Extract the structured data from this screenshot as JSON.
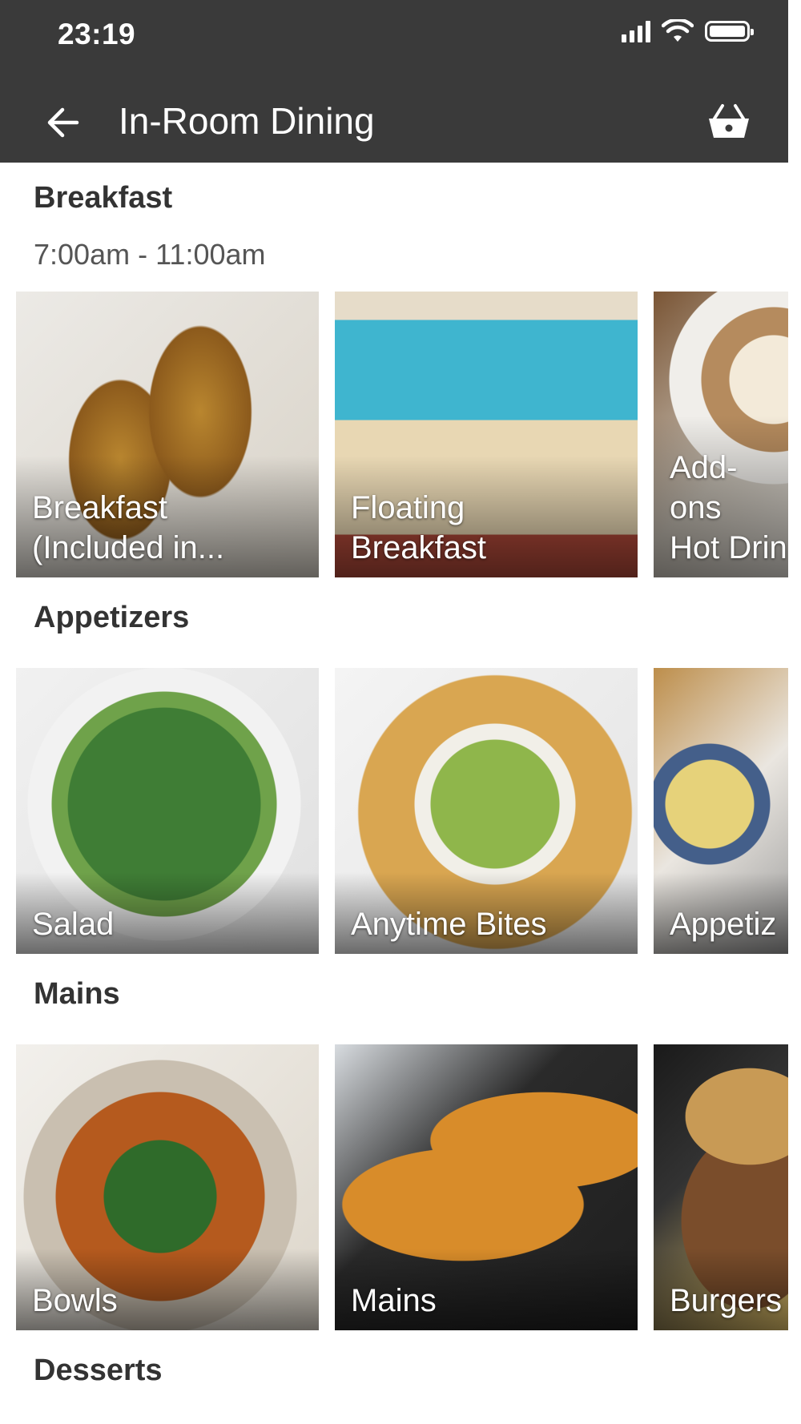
{
  "status_bar": {
    "time": "23:19"
  },
  "header": {
    "title": "In-Room Dining"
  },
  "sections": [
    {
      "title": "Breakfast",
      "subtitle": "7:00am - 11:00am",
      "items": [
        {
          "label": "Breakfast\n(Included in..."
        },
        {
          "label": "Floating\nBreakfast"
        },
        {
          "label": "Add-ons\nHot Drin"
        }
      ]
    },
    {
      "title": "Appetizers",
      "items": [
        {
          "label": "Salad"
        },
        {
          "label": "Anytime Bites"
        },
        {
          "label": "Appetiz"
        }
      ]
    },
    {
      "title": "Mains",
      "items": [
        {
          "label": "Bowls"
        },
        {
          "label": "Mains"
        },
        {
          "label": "Burgers"
        }
      ]
    },
    {
      "title": "Desserts"
    }
  ],
  "colors": {
    "header_bg": "#3a3a3a",
    "text_dark": "#333333",
    "text_muted": "#555555"
  },
  "icons": {
    "back": "arrow-left-icon",
    "cart": "basket-icon",
    "signal": "cellular-signal-icon",
    "wifi": "wifi-icon",
    "battery": "battery-icon"
  }
}
